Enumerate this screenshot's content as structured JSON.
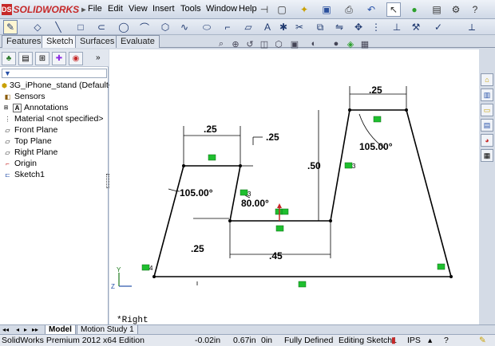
{
  "app": {
    "logo_text": "SOLIDWORKS",
    "logo_mark": "DS"
  },
  "menu": [
    "File",
    "Edit",
    "View",
    "Insert",
    "Tools",
    "Window",
    "Help"
  ],
  "command_tabs": [
    {
      "label": "Features",
      "active": false
    },
    {
      "label": "Sketch",
      "active": true
    },
    {
      "label": "Surfaces",
      "active": false
    },
    {
      "label": "Evaluate",
      "active": false
    }
  ],
  "filter_icon": "filter-icon",
  "tree": {
    "root": "3G_iPhone_stand  (Default<<",
    "items": [
      {
        "label": "Sensors",
        "icon": "sensors-icon"
      },
      {
        "label": "Annotations",
        "icon": "annotations-icon"
      },
      {
        "label": "Material <not specified>",
        "icon": "material-icon"
      },
      {
        "label": "Front Plane",
        "icon": "plane-icon"
      },
      {
        "label": "Top Plane",
        "icon": "plane-icon"
      },
      {
        "label": "Right Plane",
        "icon": "plane-icon"
      },
      {
        "label": "Origin",
        "icon": "origin-icon"
      },
      {
        "label": "Sketch1",
        "icon": "sketch-icon"
      }
    ]
  },
  "sketch": {
    "dim_top_left": ".25",
    "dim_top_mid": ".25",
    "dim_top_right": ".25",
    "dim_height": ".50",
    "dim_bottom_left": ".25",
    "dim_bottom_mid": ".45",
    "angle_left": "105.00°",
    "angle_mid": "80.00°",
    "angle_right": "105.00°",
    "relation_3a": "3",
    "relation_3b": "3",
    "relation_4": "4"
  },
  "view_label": "*Right",
  "triad": {
    "x": "X",
    "y": "Y",
    "z": "Z"
  },
  "bottom_tabs": [
    "Model",
    "Motion Study 1"
  ],
  "status": {
    "edition": "SolidWorks Premium 2012 x64 Edition",
    "x": "-0.02in",
    "y": "0.67in",
    "z": "0in",
    "state": "Fully Defined",
    "editing": "Editing Sketch1",
    "units": "IPS"
  },
  "colors": {
    "relation_green": "#1fbf2f",
    "sketch_line": "#000000",
    "accent_blue": "#2650a8"
  }
}
